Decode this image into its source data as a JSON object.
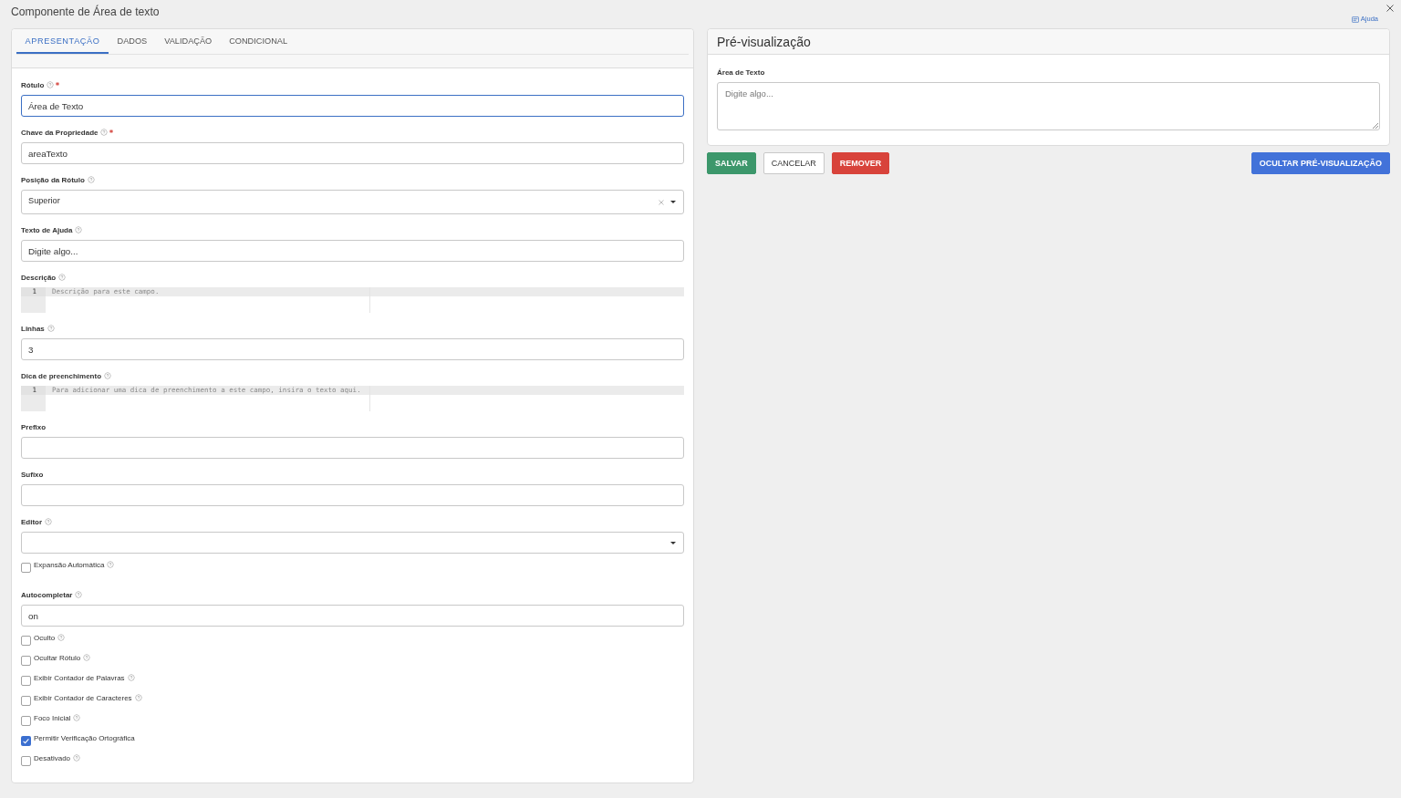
{
  "dialog": {
    "title": "Componente de Área de texto",
    "help_link": "Ajuda"
  },
  "tabs": [
    {
      "label": "APRESENTAÇÃO",
      "selected": true
    },
    {
      "label": "DADOS",
      "selected": false
    },
    {
      "label": "VALIDAÇÃO",
      "selected": false
    },
    {
      "label": "CONDICIONAL",
      "selected": false
    }
  ],
  "fields": [
    {
      "kind": "text",
      "label": "Rótulo",
      "help": true,
      "required": true,
      "value": "Área de Texto",
      "focused": true
    },
    {
      "kind": "text",
      "label": "Chave da Propriedade",
      "help": true,
      "required": true,
      "value": "areaTexto",
      "focused": false
    },
    {
      "kind": "select",
      "label": "Posição da Rótulo",
      "help": true,
      "required": false,
      "value": "Superior",
      "clearable": true
    },
    {
      "kind": "text",
      "label": "Texto de Ajuda",
      "help": true,
      "required": false,
      "value": "Digite algo...",
      "focused": false
    },
    {
      "kind": "code",
      "label": "Descrição",
      "help": true,
      "required": false,
      "lines": [
        {
          "number": "1",
          "placeholder": "Descrição para este campo."
        }
      ]
    },
    {
      "kind": "text",
      "label": "Linhas",
      "help": true,
      "required": false,
      "value": "3",
      "focused": false
    },
    {
      "kind": "code",
      "label": "Dica de preenchimento",
      "help": true,
      "required": false,
      "lines": [
        {
          "number": "1",
          "placeholder": "Para adicionar uma dica de preenchimento a este campo, insira o texto aqui."
        }
      ]
    },
    {
      "kind": "text",
      "label": "Prefixo",
      "help": false,
      "required": false,
      "focused": false
    },
    {
      "kind": "text",
      "label": "Sufixo",
      "help": false,
      "required": false,
      "focused": false
    },
    {
      "kind": "select",
      "label": "Editor",
      "help": true,
      "required": false,
      "clearable": false
    },
    {
      "kind": "checkbox",
      "label": "Expansão Automática",
      "help": true,
      "checked": false
    },
    {
      "kind": "text",
      "label": "Autocompletar",
      "help": true,
      "required": false,
      "value": "on",
      "focused": false
    },
    {
      "kind": "checkbox",
      "label": "Oculto",
      "help": true,
      "checked": false
    },
    {
      "kind": "checkbox",
      "label": "Ocultar Rótulo",
      "help": true,
      "checked": false
    },
    {
      "kind": "checkbox",
      "label": "Exibir Contador de Palavras",
      "help": true,
      "checked": false
    },
    {
      "kind": "checkbox",
      "label": "Exibir Contador de Caracteres",
      "help": true,
      "checked": false
    },
    {
      "kind": "checkbox",
      "label": "Foco Inicial",
      "help": true,
      "checked": false
    },
    {
      "kind": "checkbox",
      "label": "Permitir Verificação Ortográfica",
      "help": false,
      "checked": true
    },
    {
      "kind": "checkbox",
      "label": "Desativado",
      "help": true,
      "checked": false
    }
  ],
  "preview": {
    "title": "Pré-visualização",
    "field_label": "Área de Texto",
    "placeholder": "Digite algo..."
  },
  "actions": [
    {
      "label": "SALVAR",
      "kind": "success"
    },
    {
      "label": "CANCELAR",
      "kind": "default"
    },
    {
      "label": "REMOVER",
      "kind": "danger"
    }
  ],
  "preview_button": {
    "label": "OCULTAR PRÉ-VISUALIZAÇÃO",
    "kind": "primary"
  }
}
